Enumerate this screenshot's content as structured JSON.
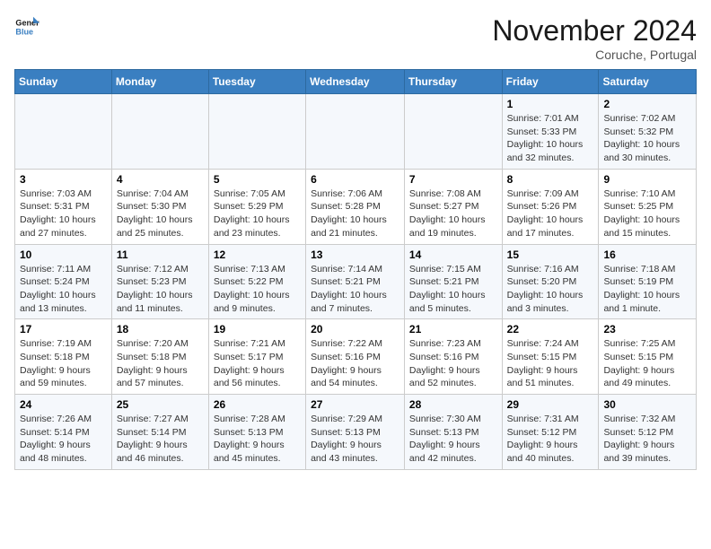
{
  "header": {
    "logo_line1": "General",
    "logo_line2": "Blue",
    "month_title": "November 2024",
    "location": "Coruche, Portugal"
  },
  "weekdays": [
    "Sunday",
    "Monday",
    "Tuesday",
    "Wednesday",
    "Thursday",
    "Friday",
    "Saturday"
  ],
  "weeks": [
    [
      {
        "day": "",
        "info": ""
      },
      {
        "day": "",
        "info": ""
      },
      {
        "day": "",
        "info": ""
      },
      {
        "day": "",
        "info": ""
      },
      {
        "day": "",
        "info": ""
      },
      {
        "day": "1",
        "info": "Sunrise: 7:01 AM\nSunset: 5:33 PM\nDaylight: 10 hours\nand 32 minutes."
      },
      {
        "day": "2",
        "info": "Sunrise: 7:02 AM\nSunset: 5:32 PM\nDaylight: 10 hours\nand 30 minutes."
      }
    ],
    [
      {
        "day": "3",
        "info": "Sunrise: 7:03 AM\nSunset: 5:31 PM\nDaylight: 10 hours\nand 27 minutes."
      },
      {
        "day": "4",
        "info": "Sunrise: 7:04 AM\nSunset: 5:30 PM\nDaylight: 10 hours\nand 25 minutes."
      },
      {
        "day": "5",
        "info": "Sunrise: 7:05 AM\nSunset: 5:29 PM\nDaylight: 10 hours\nand 23 minutes."
      },
      {
        "day": "6",
        "info": "Sunrise: 7:06 AM\nSunset: 5:28 PM\nDaylight: 10 hours\nand 21 minutes."
      },
      {
        "day": "7",
        "info": "Sunrise: 7:08 AM\nSunset: 5:27 PM\nDaylight: 10 hours\nand 19 minutes."
      },
      {
        "day": "8",
        "info": "Sunrise: 7:09 AM\nSunset: 5:26 PM\nDaylight: 10 hours\nand 17 minutes."
      },
      {
        "day": "9",
        "info": "Sunrise: 7:10 AM\nSunset: 5:25 PM\nDaylight: 10 hours\nand 15 minutes."
      }
    ],
    [
      {
        "day": "10",
        "info": "Sunrise: 7:11 AM\nSunset: 5:24 PM\nDaylight: 10 hours\nand 13 minutes."
      },
      {
        "day": "11",
        "info": "Sunrise: 7:12 AM\nSunset: 5:23 PM\nDaylight: 10 hours\nand 11 minutes."
      },
      {
        "day": "12",
        "info": "Sunrise: 7:13 AM\nSunset: 5:22 PM\nDaylight: 10 hours\nand 9 minutes."
      },
      {
        "day": "13",
        "info": "Sunrise: 7:14 AM\nSunset: 5:21 PM\nDaylight: 10 hours\nand 7 minutes."
      },
      {
        "day": "14",
        "info": "Sunrise: 7:15 AM\nSunset: 5:21 PM\nDaylight: 10 hours\nand 5 minutes."
      },
      {
        "day": "15",
        "info": "Sunrise: 7:16 AM\nSunset: 5:20 PM\nDaylight: 10 hours\nand 3 minutes."
      },
      {
        "day": "16",
        "info": "Sunrise: 7:18 AM\nSunset: 5:19 PM\nDaylight: 10 hours\nand 1 minute."
      }
    ],
    [
      {
        "day": "17",
        "info": "Sunrise: 7:19 AM\nSunset: 5:18 PM\nDaylight: 9 hours\nand 59 minutes."
      },
      {
        "day": "18",
        "info": "Sunrise: 7:20 AM\nSunset: 5:18 PM\nDaylight: 9 hours\nand 57 minutes."
      },
      {
        "day": "19",
        "info": "Sunrise: 7:21 AM\nSunset: 5:17 PM\nDaylight: 9 hours\nand 56 minutes."
      },
      {
        "day": "20",
        "info": "Sunrise: 7:22 AM\nSunset: 5:16 PM\nDaylight: 9 hours\nand 54 minutes."
      },
      {
        "day": "21",
        "info": "Sunrise: 7:23 AM\nSunset: 5:16 PM\nDaylight: 9 hours\nand 52 minutes."
      },
      {
        "day": "22",
        "info": "Sunrise: 7:24 AM\nSunset: 5:15 PM\nDaylight: 9 hours\nand 51 minutes."
      },
      {
        "day": "23",
        "info": "Sunrise: 7:25 AM\nSunset: 5:15 PM\nDaylight: 9 hours\nand 49 minutes."
      }
    ],
    [
      {
        "day": "24",
        "info": "Sunrise: 7:26 AM\nSunset: 5:14 PM\nDaylight: 9 hours\nand 48 minutes."
      },
      {
        "day": "25",
        "info": "Sunrise: 7:27 AM\nSunset: 5:14 PM\nDaylight: 9 hours\nand 46 minutes."
      },
      {
        "day": "26",
        "info": "Sunrise: 7:28 AM\nSunset: 5:13 PM\nDaylight: 9 hours\nand 45 minutes."
      },
      {
        "day": "27",
        "info": "Sunrise: 7:29 AM\nSunset: 5:13 PM\nDaylight: 9 hours\nand 43 minutes."
      },
      {
        "day": "28",
        "info": "Sunrise: 7:30 AM\nSunset: 5:13 PM\nDaylight: 9 hours\nand 42 minutes."
      },
      {
        "day": "29",
        "info": "Sunrise: 7:31 AM\nSunset: 5:12 PM\nDaylight: 9 hours\nand 40 minutes."
      },
      {
        "day": "30",
        "info": "Sunrise: 7:32 AM\nSunset: 5:12 PM\nDaylight: 9 hours\nand 39 minutes."
      }
    ]
  ]
}
